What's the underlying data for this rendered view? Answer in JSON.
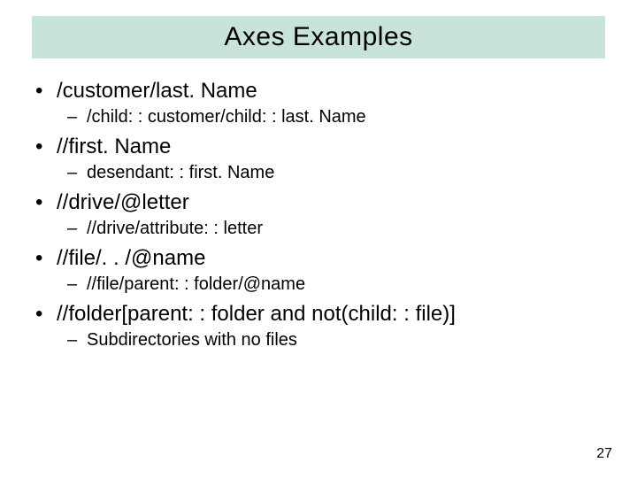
{
  "title": "Axes Examples",
  "bullets": [
    {
      "level": 1,
      "text": "/customer/last. Name"
    },
    {
      "level": 2,
      "text": "/child: : customer/child: : last. Name"
    },
    {
      "level": 1,
      "text": "//first. Name"
    },
    {
      "level": 2,
      "text": "desendant: : first. Name"
    },
    {
      "level": 1,
      "text": "//drive/@letter"
    },
    {
      "level": 2,
      "text": "//drive/attribute: : letter"
    },
    {
      "level": 1,
      "text": "//file/. . /@name"
    },
    {
      "level": 2,
      "text": "//file/parent: : folder/@name"
    },
    {
      "level": 1,
      "text": "//folder[parent: : folder and not(child: : file)]"
    },
    {
      "level": 2,
      "text": "Subdirectories with no files"
    }
  ],
  "pageNumber": "27",
  "colors": {
    "titleBar": "#c8e2dc",
    "text": "#000000",
    "background": "#ffffff"
  }
}
